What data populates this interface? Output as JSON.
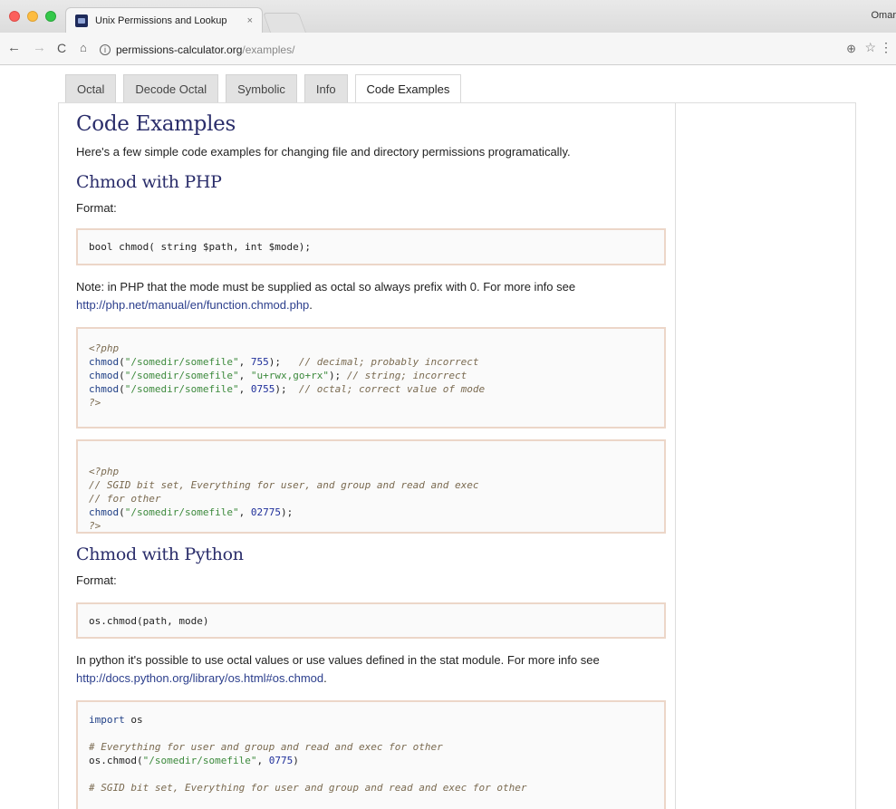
{
  "browser": {
    "tab_title": "Unix Permissions and Lookup",
    "tab_close": "×",
    "profile": "Omar",
    "url_host": "permissions-calculator.org",
    "url_path": "/examples/"
  },
  "icons": {
    "back": "←",
    "forward": "→",
    "reload": "C",
    "home": "⌂",
    "info": "i",
    "zoom": "⊕",
    "star": "☆",
    "menu": "⋮"
  },
  "page": {
    "tabs": [
      "Octal",
      "Decode Octal",
      "Symbolic",
      "Info",
      "Code Examples"
    ],
    "active_tab": "Code Examples",
    "title": "Code Examples",
    "intro": "Here's a few simple code examples for changing file and directory permissions programatically.",
    "php": {
      "heading": "Chmod with PHP",
      "format_label": "Format:",
      "format_code": "bool chmod( string $path, int $mode);",
      "note_text": "Note: in PHP that the mode must be supplied as octal so always prefix with 0. For more info see",
      "note_link": "http://php.net/manual/en/function.chmod.php",
      "note_end": ".",
      "example1": {
        "open_tag": "<?php",
        "fn": "chmod",
        "path": "\"/somedir/somefile\"",
        "arg1": "755",
        "comment1": "// decimal; probably incorrect",
        "arg2": "\"u+rwx,go+rx\"",
        "comment2": "// string; incorrect",
        "arg3": "0755",
        "comment3": "// octal; correct value of mode",
        "close_tag": "?>"
      },
      "example2": {
        "open_tag": "<?php",
        "comment1": "// SGID bit set, Everything for user, and group and read and exec",
        "comment2": "// for other",
        "fn": "chmod",
        "path": "\"/somedir/somefile\"",
        "arg": "02775",
        "close_tag": "?>"
      }
    },
    "python": {
      "heading": "Chmod with Python",
      "format_label": "Format:",
      "format_code": "os.chmod(path, mode)",
      "note_text": "In python it's possible to use octal values or use values defined in the stat module. For more info see",
      "note_link": "http://docs.python.org/library/os.html#os.chmod",
      "note_end": ".",
      "example1": {
        "import_kw": "import",
        "import_mod": "os",
        "comment1": "# Everything for user and group and read and exec for other",
        "fn": "os.chmod",
        "path": "\"/somedir/somefile\"",
        "arg": "0775",
        "comment2": "# SGID bit set, Everything for user and group and read and exec for other"
      }
    }
  }
}
